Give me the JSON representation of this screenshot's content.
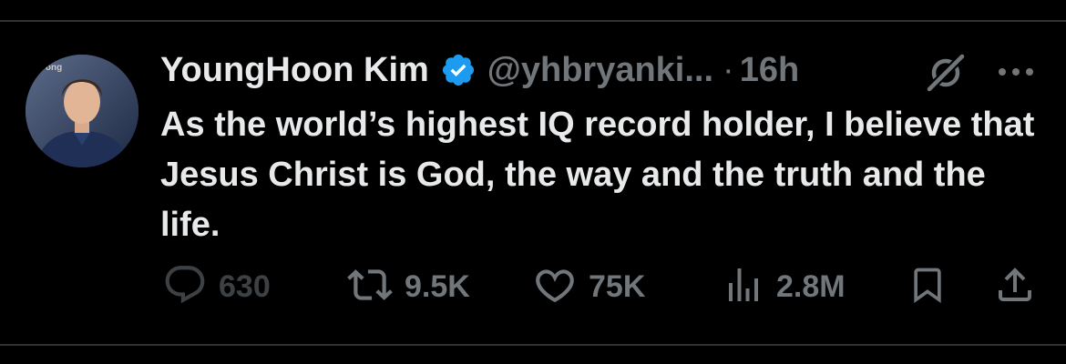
{
  "tweet": {
    "author_name": "YoungHoon Kim",
    "handle": "@yhbryanki...",
    "separator": "·",
    "time": "16h",
    "text": "As the world’s highest IQ record holder, I believe that Jesus Christ is God, the way and the truth and the life.",
    "verified": true,
    "avatar_badge_text": "rong"
  },
  "actions": {
    "reply": {
      "icon": "reply-icon",
      "count": "630"
    },
    "retweet": {
      "icon": "retweet-icon",
      "count": "9.5K"
    },
    "like": {
      "icon": "heart-icon",
      "count": "75K"
    },
    "views": {
      "icon": "views-icon",
      "count": "2.8M"
    },
    "bookmark": {
      "icon": "bookmark-icon"
    },
    "share": {
      "icon": "share-icon"
    }
  },
  "header_icons": [
    "grok-icon",
    "more-icon"
  ],
  "colors": {
    "background": "#000000",
    "text": "#e7e9ea",
    "secondary": "#71767b",
    "verified": "#1d9bf0",
    "divider": "#2f3336"
  }
}
